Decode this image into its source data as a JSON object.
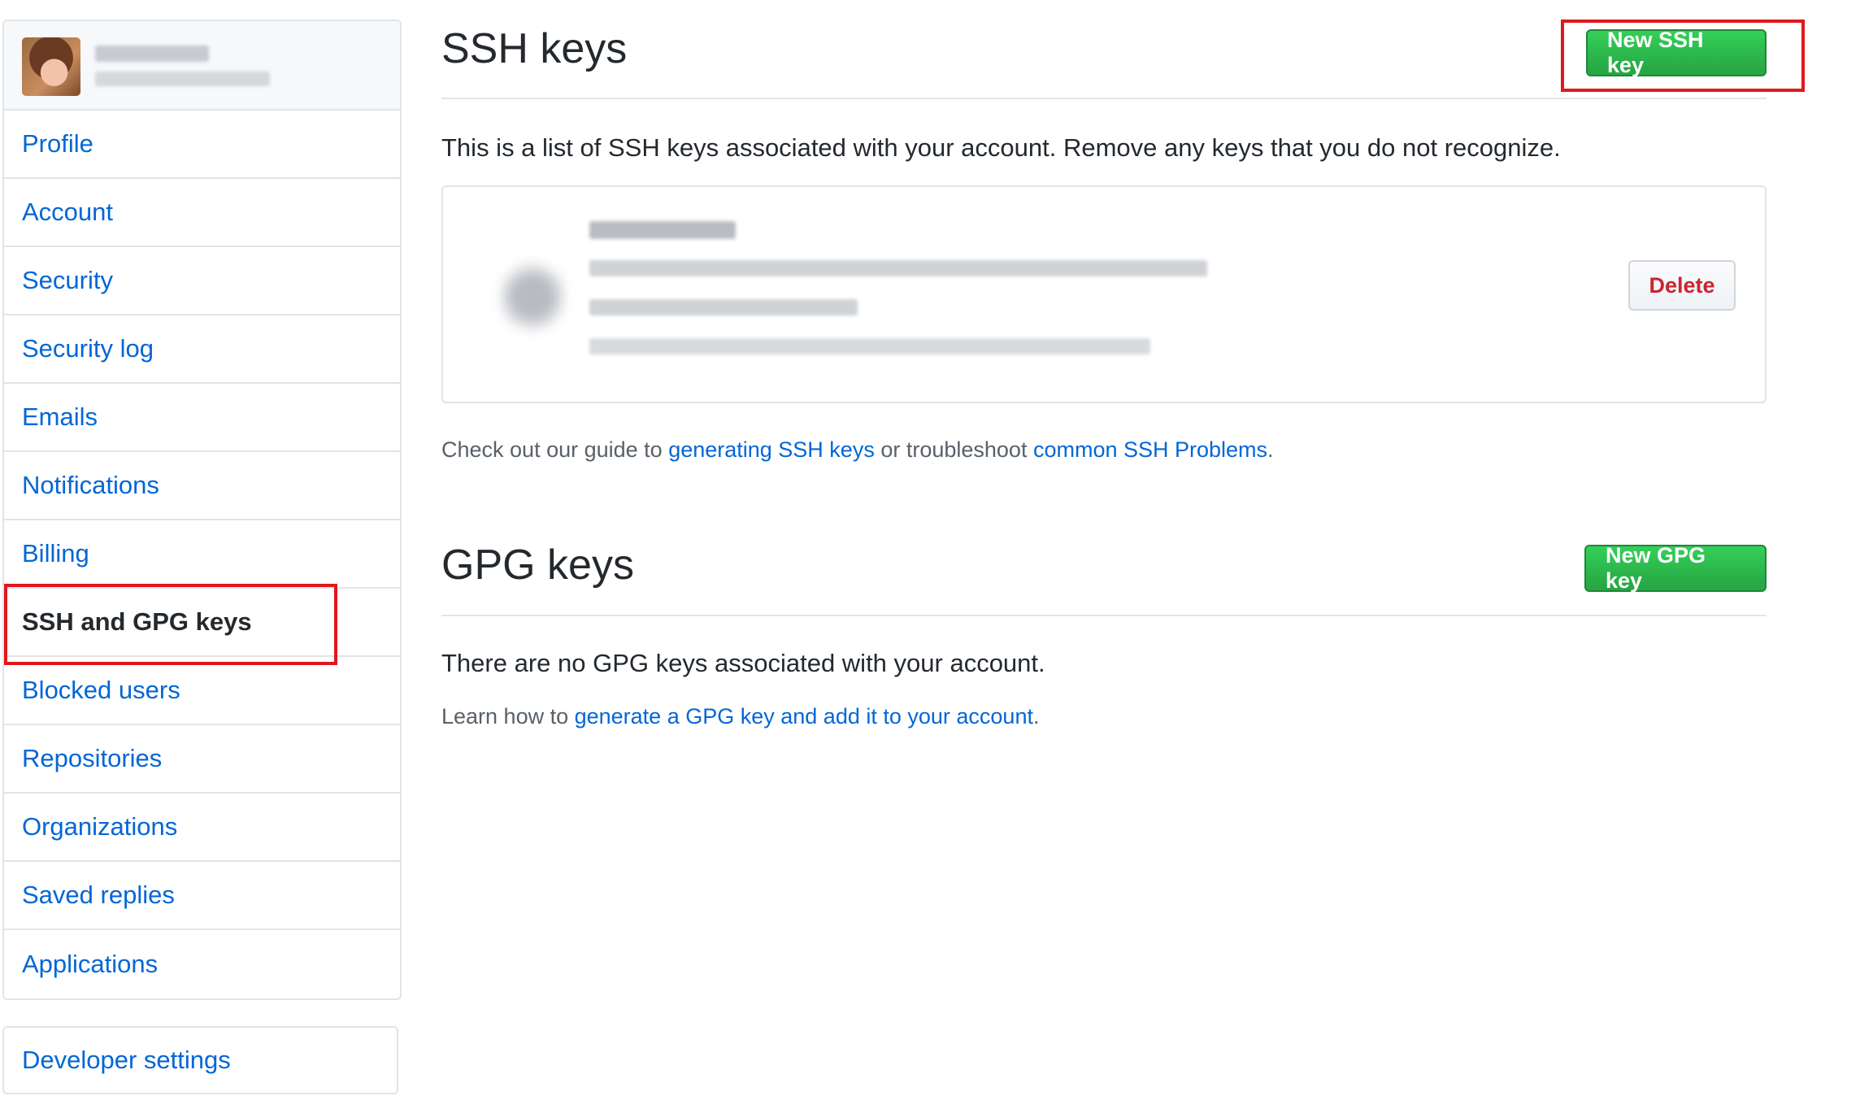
{
  "sidebar": {
    "items": [
      {
        "label": "Profile"
      },
      {
        "label": "Account"
      },
      {
        "label": "Security"
      },
      {
        "label": "Security log"
      },
      {
        "label": "Emails"
      },
      {
        "label": "Notifications"
      },
      {
        "label": "Billing"
      },
      {
        "label": "SSH and GPG keys",
        "selected": true
      },
      {
        "label": "Blocked users"
      },
      {
        "label": "Repositories"
      },
      {
        "label": "Organizations"
      },
      {
        "label": "Saved replies"
      },
      {
        "label": "Applications"
      }
    ],
    "developer_settings": "Developer settings"
  },
  "ssh": {
    "title": "SSH keys",
    "new_button": "New SSH key",
    "description": "This is a list of SSH keys associated with your account. Remove any keys that you do not recognize.",
    "delete_button": "Delete",
    "guide_prefix": "Check out our guide to ",
    "guide_link": "generating SSH keys",
    "guide_middle": " or troubleshoot ",
    "problems_link": "common SSH Problems",
    "guide_suffix": "."
  },
  "gpg": {
    "title": "GPG keys",
    "new_button": "New GPG key",
    "empty_text": "There are no GPG keys associated with your account.",
    "learn_prefix": "Learn how to ",
    "learn_link": "generate a GPG key and add it to your account",
    "learn_suffix": "."
  },
  "colors": {
    "link": "#0366d6",
    "green_button": "#28a745",
    "delete_text": "#cb2431",
    "highlight_box": "#e0181c"
  }
}
